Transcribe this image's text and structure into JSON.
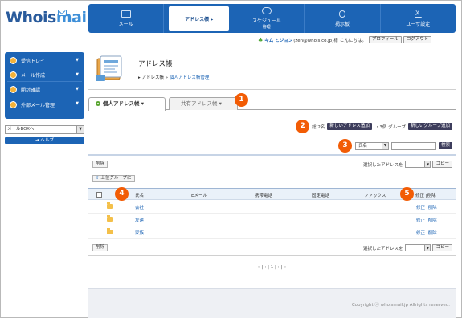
{
  "logo": {
    "part1": "Whois",
    "part2": "mail"
  },
  "nav": [
    {
      "label": "メール",
      "sub": "",
      "icon": "mail-icon"
    },
    {
      "label": "アドレス帳 ▸",
      "sub": "",
      "icon": "address-book-icon"
    },
    {
      "label": "スケジュール",
      "sub": "管理",
      "icon": "schedule-icon"
    },
    {
      "label": "掲示板",
      "sub": "",
      "icon": "board-icon"
    },
    {
      "label": "ユーザ設定",
      "sub": "",
      "icon": "user-settings-icon"
    }
  ],
  "user": {
    "name": "キム ヒジョン",
    "email": "(zen@whois.co.jp)様",
    "greeting": "こんにちは。",
    "profile": "プロフィール",
    "logout": "ログアウト"
  },
  "sidebar": {
    "items": [
      {
        "label": "受信トレイ",
        "icon": "inbox-icon"
      },
      {
        "label": "メール作成",
        "icon": "compose-icon"
      },
      {
        "label": "開封確認",
        "icon": "read-receipt-icon"
      },
      {
        "label": "外部メール管理",
        "icon": "external-mail-icon"
      }
    ],
    "mailbox": "メールBOXへ",
    "help": "ヘルプ"
  },
  "page": {
    "title": "アドレス帳",
    "crumb1": "アドレス帳",
    "crumb_sep": " » ",
    "crumb2": "個人アドレス帳管理"
  },
  "tabs": {
    "personal": "個人アドレス帳",
    "shared": "共有アドレス帳"
  },
  "badges": [
    "1",
    "2",
    "3",
    "4",
    "5"
  ],
  "counts": {
    "total": "総 2名",
    "new_address": "新しいアドレス追加",
    "group": "・3個 グループ",
    "new_group": "新しいグループ追加"
  },
  "search": {
    "field": "氏名",
    "button": "検索"
  },
  "toolbar": {
    "delete": "削除",
    "move_label": "選択したアドレスを",
    "copy": "コピー",
    "up_group": "上位グループに"
  },
  "table": {
    "headers": [
      "氏名",
      "Eメール",
      "携帯電話",
      "固定電話",
      "ファックス",
      "修正 |削除"
    ],
    "rows": [
      {
        "name": "会社",
        "actions": "修正 |削除"
      },
      {
        "name": "友達",
        "actions": "修正 |削除"
      },
      {
        "name": "家族",
        "actions": "修正 |削除"
      }
    ]
  },
  "pager": {
    "first": "«",
    "prev": "‹",
    "page": "1",
    "next": "›",
    "last": "»"
  },
  "footer": {
    "copyright": "Copyright ⓒ whoismail.jp Allrights reserved."
  },
  "colors": {
    "brand": "#1c64b5",
    "badge": "#f25c05"
  }
}
